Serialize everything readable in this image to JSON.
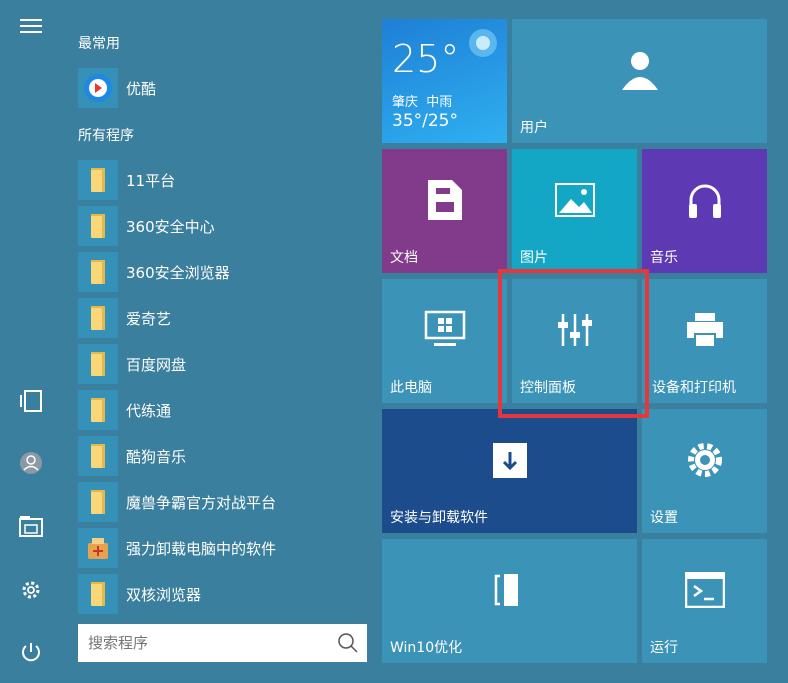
{
  "sidebar": {
    "menu": "hamburger-icon",
    "icons": [
      "tablet-mode-icon",
      "user-icon",
      "file-explorer-icon",
      "settings-icon",
      "power-icon"
    ]
  },
  "sections": {
    "frequent": "最常用",
    "all": "所有程序"
  },
  "apps": [
    {
      "label": "优酷",
      "icon": "youku-icon"
    },
    {
      "label": "11平台",
      "icon": "folder-icon"
    },
    {
      "label": "360安全中心",
      "icon": "folder-icon"
    },
    {
      "label": "360安全浏览器",
      "icon": "folder-icon"
    },
    {
      "label": "爱奇艺",
      "icon": "folder-icon"
    },
    {
      "label": "百度网盘",
      "icon": "folder-icon"
    },
    {
      "label": "代练通",
      "icon": "folder-icon"
    },
    {
      "label": "酷狗音乐",
      "icon": "folder-icon"
    },
    {
      "label": "魔兽争霸官方对战平台",
      "icon": "folder-icon"
    },
    {
      "label": "强力卸载电脑中的软件",
      "icon": "uninstall-icon"
    },
    {
      "label": "双核浏览器",
      "icon": "folder-icon"
    }
  ],
  "search": {
    "placeholder": "搜索程序"
  },
  "weather": {
    "temp": "25°",
    "city": "肇庆",
    "condition": "中雨",
    "range": "35°/25°"
  },
  "tiles": {
    "user": "用户",
    "docs": "文档",
    "pictures": "图片",
    "music": "音乐",
    "computer": "此电脑",
    "control": "控制面板",
    "devices": "设备和打印机",
    "install": "安装与卸载软件",
    "settings": "设置",
    "win10": "Win10优化",
    "run": "运行"
  },
  "colors": {
    "background": "#3a7f9d",
    "highlight": "#e5383b"
  }
}
